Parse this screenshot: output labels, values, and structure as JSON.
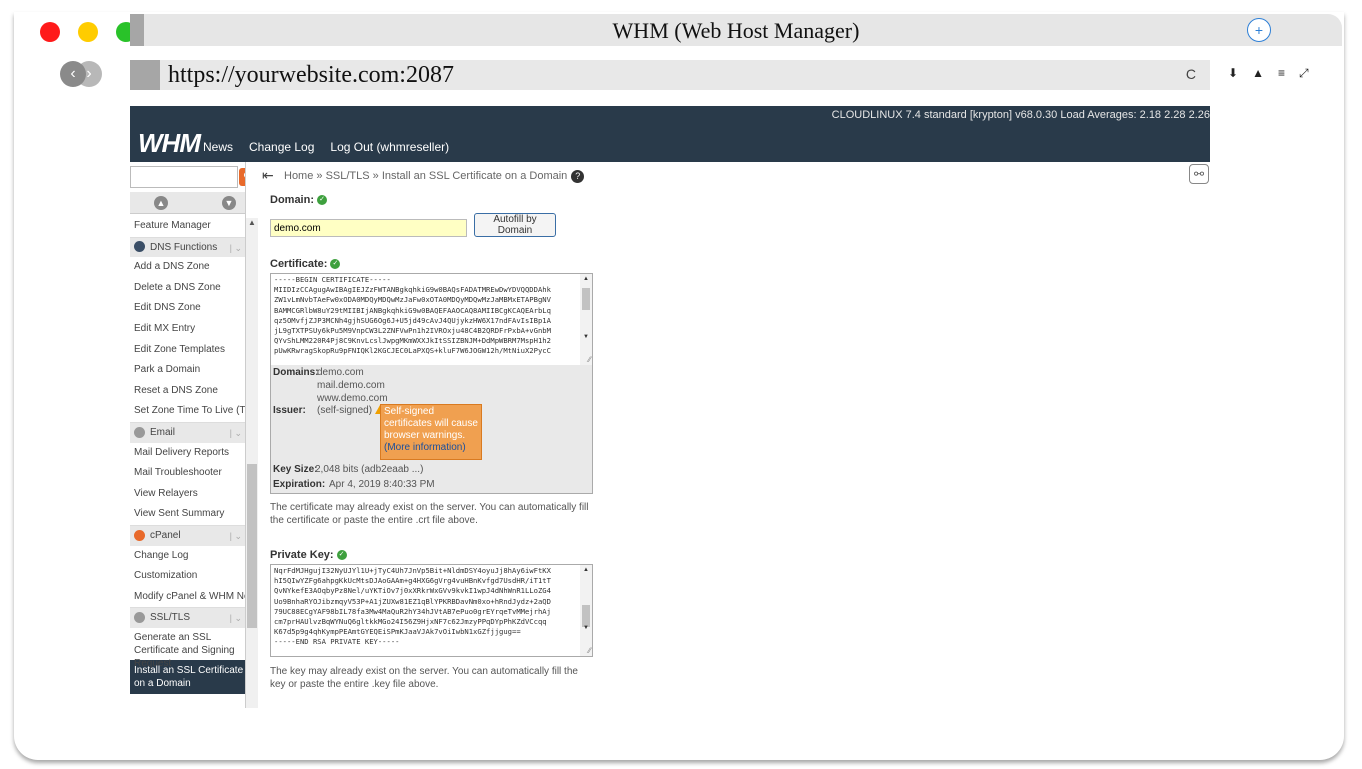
{
  "browser": {
    "window_title": "WHM (Web Host Manager)",
    "new_tab_label": "+",
    "url": "https://yourwebsite.com:2087",
    "reload_glyph": "C"
  },
  "header": {
    "logo": "WHM",
    "system_info": "CLOUDLINUX 7.4 standard [krypton]   v68.0.30   Load Averages: 2.18 2.28 2.26",
    "links": [
      "News",
      "Change Log",
      "Log Out (whmreseller)"
    ]
  },
  "breadcrumb": "Home » SSL/TLS » Install an SSL Certificate on a Domain",
  "sidebar": {
    "items_a": [
      "Feature Manager"
    ],
    "group_dns": "DNS Functions",
    "items_dns": [
      "Add a DNS Zone",
      "Delete a DNS Zone",
      "Edit DNS Zone",
      "Edit MX Entry",
      "Edit Zone Templates",
      "Park a Domain",
      "Reset a DNS Zone",
      "Set Zone Time To Live (TTL)"
    ],
    "group_email": "Email",
    "items_email": [
      "Mail Delivery Reports",
      "Mail Troubleshooter",
      "View Relayers",
      "View Sent Summary"
    ],
    "group_cpanel": "cPanel",
    "items_cpanel": [
      "Change Log",
      "Customization",
      "Modify cPanel & WHM News"
    ],
    "group_ssl": "SSL/TLS",
    "item_csr": "Generate an SSL Certificate and Signing Request",
    "item_active": "Install an SSL Certificate on a Domain"
  },
  "form": {
    "domain_label": "Domain:",
    "domain_value": "demo.com",
    "autofill_label": "Autofill by Domain",
    "certificate_label": "Certificate:",
    "certificate_text": "-----BEGIN CERTIFICATE-----\nMIIDIzCCAgugAwIBAgIEJZzFWTANBgkqhkiG9w0BAQsFADATMREwDwYDVQQDDAhk\nZW1vLmNvbTAeFw0xODA0MDQyMDQwMzJaFw0xOTA0MDQyMDQwMzJaMBMxETAPBgNV\nBAMMCGRlbW8uY29tMIIBIjANBgkqhkiG9w0BAQEFAAOCAQ8AMIIBCgKCAQEArbLq\nqz5OMvfjZJP3MCNh4gjhSUG6Og6J+U5jd49cAvJ4QUjykzHW6X17ndFAvIsIBp1A\njL9gTXTPSUy6kPu5M9VnpCW3L2ZNFVwPn1h2IVROxju48C4B2QRDFrPxbA+vGnbM\nQYvShLMM220R4Pj8C9KnvLcslJwpgMKmWXXJkItSSIZBNJM+DdMpWBRM7MspH1h2\npUwKRwragSkopRu9pFNIQKl2KGCJEC0LaPXQS+kluF7W6JOGW12h/MtNiuX2PycC",
    "domains_label": "Domains:",
    "domains": [
      "demo.com",
      "mail.demo.com",
      "www.demo.com"
    ],
    "issuer_label": "Issuer:",
    "issuer_value": "(self-signed)",
    "warning_text": "Self-signed certificates will cause browser warnings.",
    "warning_link": "(More information)",
    "keysize_label": "Key Size:",
    "keysize_value": "2,048 bits (adb2eaab ...)",
    "expiration_label": "Expiration:",
    "expiration_value": "Apr 4, 2019 8:40:33 PM",
    "certificate_note": "The certificate may already exist on the server. You can automatically fill the certificate or paste the entire .crt file above.",
    "private_key_label": "Private Key:",
    "private_key_text": "NqrFdMJHgujI32NyUJYl1U+jTyC4Uh7JnVp5Bit+NldmDSY4oyuJj8hAy6iwFtKX\nhI5QIwYZFg6ahpgKkUcMtsDJAoGAAm+g4HXG6gVrg4vuHBnKvfgd7UsdHR/iT1tT\nQvNYkefE3AOqbyPz8Nel/uYKTiOv7j0xXRkrWxGVv9kvkI1wpJ4dNhWnR1LLoZG4\nUo9BnhaRYOJibzmqyV53P+A1jZUXw81EZ1qBlYPKRBDavNm0xo+hRndJydz+2aQD\n79UC88ECgYAF98bIL78fa3Mw4MaQuR2hY34hJVtAB7ePuo0grEYrqeTvMMejrhAj\ncm7prHAUlvzBqWYNuQ6gltkkMGo24I56Z9HjxNF7c62JmzyPPqDYpPhKZdVCcqq\nK67d5p9g4qhKympPEAmtGYEQEiSPmKJaaVJAk7vOiIwbN1xGZfjjgug==\n-----END RSA PRIVATE KEY-----",
    "private_key_note": "The key may already exist on the server. You can automatically fill the key or paste the entire .key file above."
  },
  "colors": {
    "header_bg": "#293a4a",
    "search_button": "#e8692a",
    "domain_input_bg": "#ffffc4",
    "warning_bg": "#f0a050",
    "valid_check": "#3ea03e"
  }
}
